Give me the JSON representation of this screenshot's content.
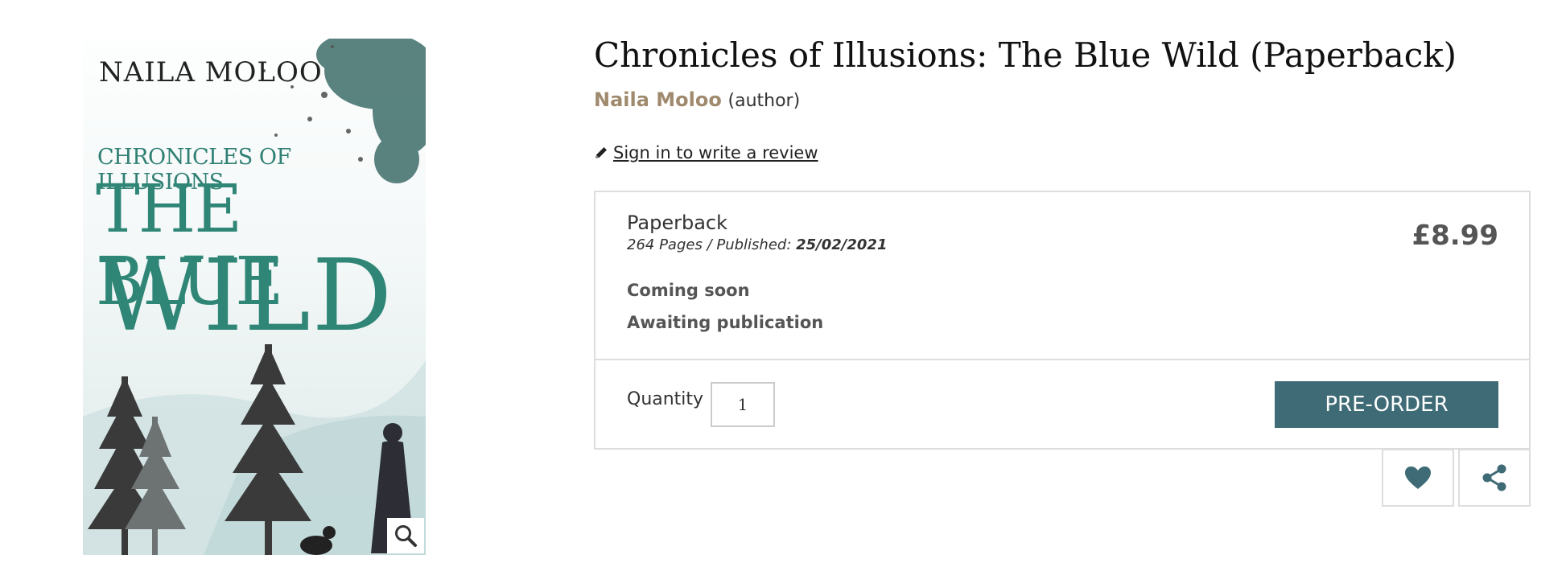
{
  "cover": {
    "author": "NAILA MOLOO",
    "series": "CHRONICLES OF ILLUSIONS",
    "title_line1": "THE BLUE",
    "title_line2": "WILD",
    "zoom_icon": "magnifier-icon"
  },
  "product": {
    "title": "Chronicles of Illusions: The Blue Wild (Paperback)",
    "author": "Naila Moloo",
    "author_role": "(author)",
    "review_link": "Sign in to write a review",
    "review_icon": "pencil-icon"
  },
  "offer": {
    "format": "Paperback",
    "meta_prefix": "264 Pages / Published: ",
    "published_date": "25/02/2021",
    "price": "£8.99",
    "availability": "Coming soon",
    "status": "Awaiting publication",
    "quantity_label": "Quantity",
    "quantity_value": "1",
    "preorder_label": "PRE-ORDER"
  },
  "actions": {
    "wishlist_icon": "heart-icon",
    "share_icon": "share-icon"
  },
  "colors": {
    "accent": "#3e6b75",
    "author_link": "#a08a6e",
    "cover_title": "#2f8676"
  }
}
